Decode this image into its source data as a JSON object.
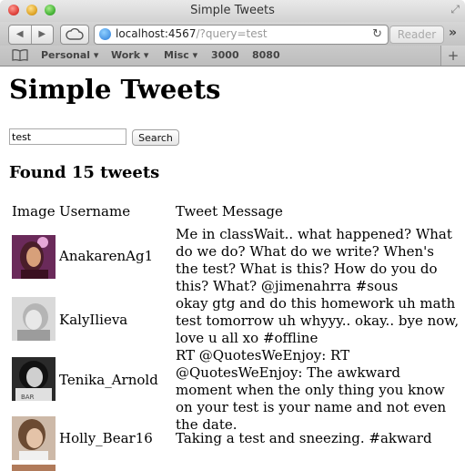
{
  "window": {
    "title": "Simple Tweets"
  },
  "toolbar": {
    "back_glyph": "◀",
    "forward_glyph": "▶",
    "url_host": "localhost:4567",
    "url_path": "/?query=test",
    "reload_glyph": "↻",
    "reader_label": "Reader",
    "more_glyph": "»"
  },
  "bookmarks": [
    "Personal ▾",
    "Work ▾",
    "Misc ▾",
    "3000",
    "8080"
  ],
  "page": {
    "title": "Simple Tweets",
    "search_value": "test",
    "search_button": "Search",
    "results_heading": "Found 15 tweets",
    "columns": {
      "image": "Image",
      "username": "Username",
      "message": "Tweet Message"
    },
    "tweets": [
      {
        "username": "AnakarenAg1",
        "message": "Me in classWait.. what happened? What do we do? What do we write? When's the test? What is this? How do you do this? What? @jimenahrra #sous"
      },
      {
        "username": "KalyIlieva",
        "message": "okay gtg and do this homework uh math test tomorrow uh whyyy.. okay.. bye now, love u all xo #offline"
      },
      {
        "username": "Tenika_Arnold",
        "message": "RT @QuotesWeEnjoy: RT @QuotesWeEnjoy: The awkward moment when the only thing you know on your test is your name and not even the date."
      },
      {
        "username": "Holly_Bear16",
        "message": "Taking a test and sneezing. #akward"
      }
    ]
  }
}
